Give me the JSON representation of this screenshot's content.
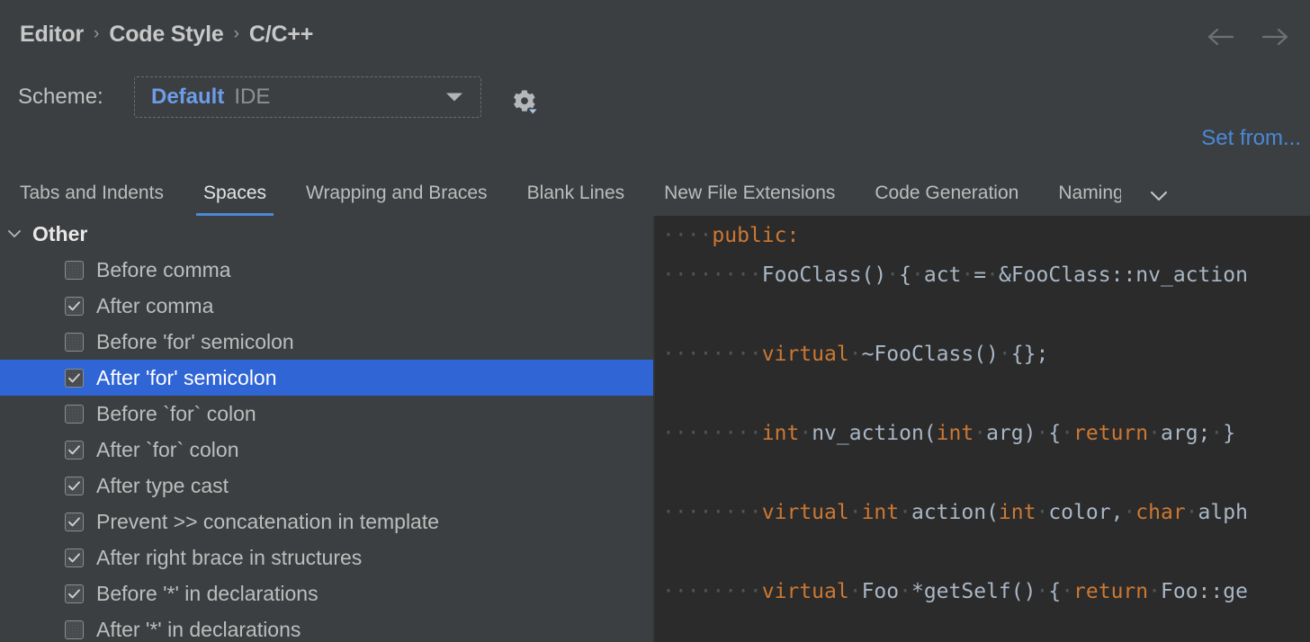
{
  "header": {
    "breadcrumb": [
      "Editor",
      "Code Style",
      "C/C++"
    ],
    "separator": "›",
    "nav_back_name": "back-arrow",
    "nav_forward_name": "forward-arrow"
  },
  "scheme": {
    "label": "Scheme:",
    "value": "Default",
    "sub_value": "IDE",
    "gear_name": "gear-icon"
  },
  "links": {
    "set_from": "Set from..."
  },
  "tabs": {
    "items": [
      {
        "label": "Tabs and Indents",
        "active": false
      },
      {
        "label": "Spaces",
        "active": true
      },
      {
        "label": "Wrapping and Braces",
        "active": false
      },
      {
        "label": "Blank Lines",
        "active": false
      },
      {
        "label": "New File Extensions",
        "active": false
      },
      {
        "label": "Code Generation",
        "active": false
      },
      {
        "label": "Naming C",
        "active": false,
        "clipped": true
      }
    ],
    "overflow_icon": "chevron-down-icon"
  },
  "settings_tree": {
    "group": {
      "label": "Other",
      "expanded": true
    },
    "items": [
      {
        "label": "Before comma",
        "checked": false,
        "selected": false
      },
      {
        "label": "After comma",
        "checked": true,
        "selected": false
      },
      {
        "label": "Before 'for' semicolon",
        "checked": false,
        "selected": false
      },
      {
        "label": "After 'for' semicolon",
        "checked": true,
        "selected": true
      },
      {
        "label": "Before `for` colon",
        "checked": false,
        "selected": false
      },
      {
        "label": "After `for` colon",
        "checked": true,
        "selected": false
      },
      {
        "label": "After type cast",
        "checked": true,
        "selected": false
      },
      {
        "label": "Prevent >> concatenation in template",
        "checked": true,
        "selected": false
      },
      {
        "label": "After right brace in structures",
        "checked": true,
        "selected": false
      },
      {
        "label": "Before '*' in declarations",
        "checked": true,
        "selected": false
      },
      {
        "label": "After '*' in declarations",
        "checked": false,
        "selected": false
      }
    ]
  },
  "code_preview": {
    "whitespace_dot": "·",
    "lines": [
      [
        {
          "t": "····",
          "c": "ws"
        },
        {
          "t": "public:",
          "c": "kw"
        }
      ],
      [
        {
          "t": "········",
          "c": "ws"
        },
        {
          "t": "FooClass()",
          "c": "pln"
        },
        {
          "t": "·",
          "c": "ws"
        },
        {
          "t": "{",
          "c": "pln"
        },
        {
          "t": "·",
          "c": "ws"
        },
        {
          "t": "act",
          "c": "pln"
        },
        {
          "t": "·",
          "c": "ws"
        },
        {
          "t": "=",
          "c": "pln"
        },
        {
          "t": "·",
          "c": "ws"
        },
        {
          "t": "&FooClass::nv_action",
          "c": "pln"
        }
      ],
      [],
      [
        {
          "t": "········",
          "c": "ws"
        },
        {
          "t": "virtual",
          "c": "kw"
        },
        {
          "t": "·",
          "c": "ws"
        },
        {
          "t": "~FooClass()",
          "c": "pln"
        },
        {
          "t": "·",
          "c": "ws"
        },
        {
          "t": "{};",
          "c": "pln"
        }
      ],
      [],
      [
        {
          "t": "········",
          "c": "ws"
        },
        {
          "t": "int",
          "c": "kw"
        },
        {
          "t": "·",
          "c": "ws"
        },
        {
          "t": "nv_action(",
          "c": "pln"
        },
        {
          "t": "int",
          "c": "kw"
        },
        {
          "t": "·",
          "c": "ws"
        },
        {
          "t": "arg)",
          "c": "pln"
        },
        {
          "t": "·",
          "c": "ws"
        },
        {
          "t": "{",
          "c": "pln"
        },
        {
          "t": "·",
          "c": "ws"
        },
        {
          "t": "return",
          "c": "kw"
        },
        {
          "t": "·",
          "c": "ws"
        },
        {
          "t": "arg;",
          "c": "pln"
        },
        {
          "t": "·",
          "c": "ws"
        },
        {
          "t": "}",
          "c": "pln"
        }
      ],
      [],
      [
        {
          "t": "········",
          "c": "ws"
        },
        {
          "t": "virtual",
          "c": "kw"
        },
        {
          "t": "·",
          "c": "ws"
        },
        {
          "t": "int",
          "c": "kw"
        },
        {
          "t": "·",
          "c": "ws"
        },
        {
          "t": "action(",
          "c": "pln"
        },
        {
          "t": "int",
          "c": "kw"
        },
        {
          "t": "·",
          "c": "ws"
        },
        {
          "t": "color,",
          "c": "pln"
        },
        {
          "t": "·",
          "c": "ws"
        },
        {
          "t": "char",
          "c": "kw"
        },
        {
          "t": "·",
          "c": "ws"
        },
        {
          "t": "alph",
          "c": "pln"
        }
      ],
      [],
      [
        {
          "t": "········",
          "c": "ws"
        },
        {
          "t": "virtual",
          "c": "kw"
        },
        {
          "t": "·",
          "c": "ws"
        },
        {
          "t": "Foo",
          "c": "pln"
        },
        {
          "t": "·",
          "c": "ws"
        },
        {
          "t": "*getSelf()",
          "c": "pln"
        },
        {
          "t": "·",
          "c": "ws"
        },
        {
          "t": "{",
          "c": "pln"
        },
        {
          "t": "·",
          "c": "ws"
        },
        {
          "t": "return",
          "c": "kw"
        },
        {
          "t": "·",
          "c": "ws"
        },
        {
          "t": "Foo::ge",
          "c": "pln"
        }
      ]
    ]
  },
  "colors": {
    "panel_bg": "#3c3f41",
    "code_bg": "#2b2b2b",
    "selection": "#2f65d4",
    "link": "#4a88d8",
    "keyword": "#cc7832",
    "code_text": "#a9b7c6",
    "accent_underline": "#4a88d8"
  }
}
